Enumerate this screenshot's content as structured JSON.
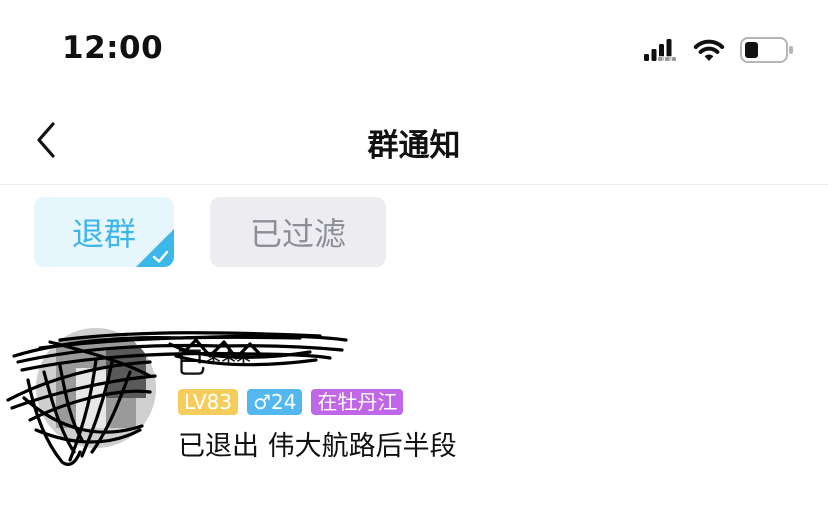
{
  "status_bar": {
    "time": "12:00",
    "icons": [
      "signal-icon",
      "wifi-icon",
      "battery-icon"
    ]
  },
  "nav": {
    "back_icon": "chevron-left-icon",
    "title": "群通知"
  },
  "filters": [
    {
      "label": "退群",
      "selected": true
    },
    {
      "label": "已过滤",
      "selected": false
    }
  ],
  "notification": {
    "name": "已***",
    "tags": {
      "level": "LV83",
      "gender_age": "♂24",
      "location": "在牡丹江"
    },
    "description": "已退出 伟大航路后半段"
  },
  "colors": {
    "accent": "#3cb7ea",
    "level_tag": "#f5cd5d",
    "gender_tag": "#52b8ef",
    "location_tag": "#c066e8"
  }
}
